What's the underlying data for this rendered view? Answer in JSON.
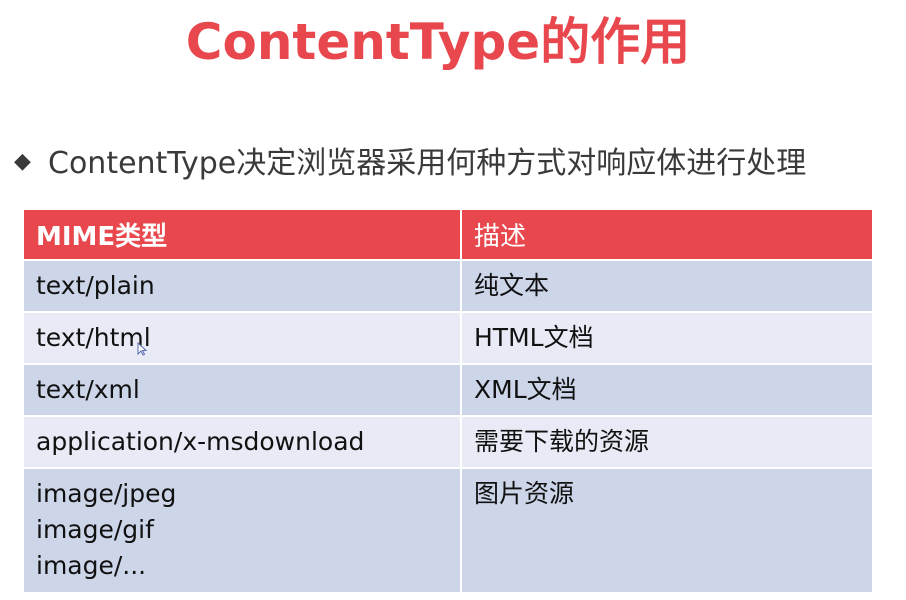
{
  "title": "ContentType的作用",
  "bullet": {
    "symbol": "◆",
    "text": "ContentType决定浏览器采用何种方式对响应体进行处理"
  },
  "table": {
    "headers": [
      "MIME类型",
      "描述"
    ],
    "rows": [
      {
        "type": "text/plain",
        "desc": "纯文本"
      },
      {
        "type": "text/html",
        "desc": "HTML文档"
      },
      {
        "type": "text/xml",
        "desc": "XML文档"
      },
      {
        "type": "application/x-msdownload",
        "desc": "需要下载的资源"
      },
      {
        "types": [
          "image/jpeg",
          "image/gif",
          "image/..."
        ],
        "desc": "图片资源"
      }
    ]
  },
  "colors": {
    "accent": "#e8484d",
    "row_dark": "#cdd5e9",
    "row_light": "#e8ebf5"
  }
}
